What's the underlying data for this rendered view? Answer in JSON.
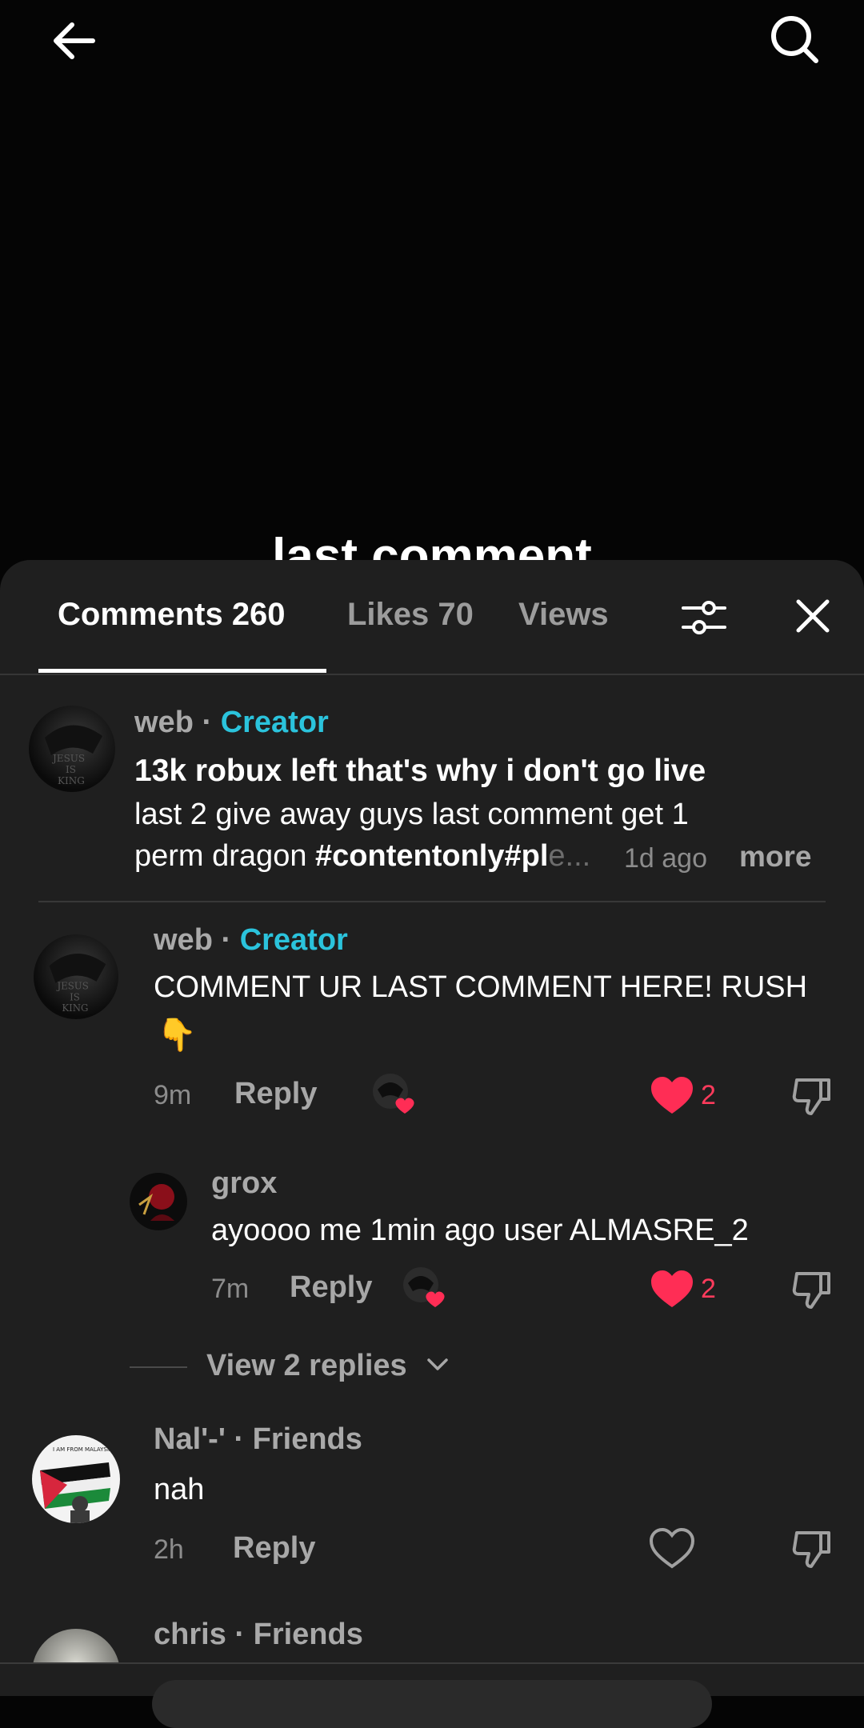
{
  "video": {
    "caption": "last comment"
  },
  "icons": {
    "back": "back-arrow-icon",
    "search": "search-icon",
    "filter": "filter-sliders-icon",
    "close": "close-icon"
  },
  "colors": {
    "accent": "#2bc3dc",
    "like": "#ff3b5c",
    "sheet": "#1f1f1f"
  },
  "tabs": {
    "comments": "Comments 260",
    "likes": "Likes 70",
    "views": "Views"
  },
  "pinned": {
    "username": "web",
    "separator": " · ",
    "badge": "Creator",
    "title": "13k robux left that's why i don't go live",
    "body_line1": "last 2 give away guys last comment get 1",
    "body_line2_plain": "perm dragon ",
    "body_line2_tags": "#contentonly#pl",
    "body_line2_fade": "e...",
    "time": "1d ago",
    "more": "more"
  },
  "comments": [
    {
      "username": "web",
      "separator": " · ",
      "badge": "Creator",
      "text": "COMMENT UR LAST COMMENT HERE! RUSH",
      "emoji": "👇",
      "time": "9m",
      "reply": "Reply",
      "likes": "2"
    },
    {
      "username": "grox",
      "text": "ayoooo me 1min ago user ALMASRE_2",
      "time": "7m",
      "reply": "Reply",
      "likes": "2"
    },
    {
      "view_replies": "View 2 replies"
    },
    {
      "username": "Nal'-'",
      "separator": " · ",
      "badge": "Friends",
      "text": "nah",
      "time": "2h",
      "reply": "Reply"
    },
    {
      "username": "chris",
      "separator": " · ",
      "badge": "Friends"
    }
  ]
}
